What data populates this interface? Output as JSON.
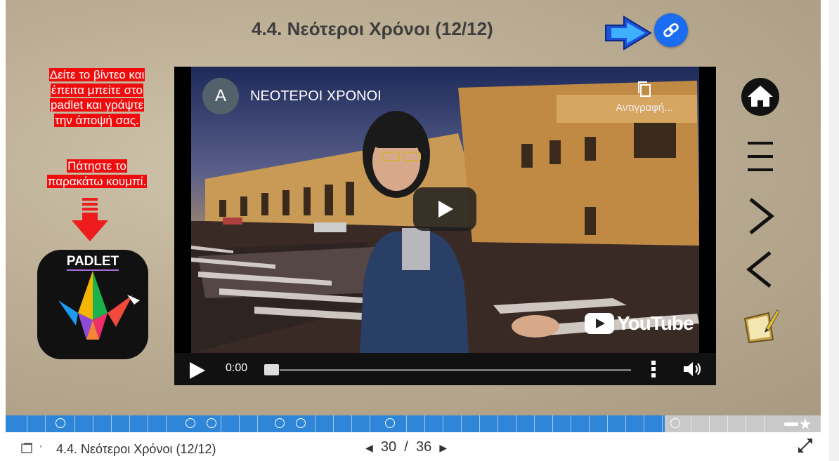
{
  "slide": {
    "title": "4.4. Νεότεροι Χρόνοι (12/12)",
    "instructions_line1": [
      "Δείτε το βίντεο και",
      "έπειτα μπείτε στο",
      "padlet και γράψτε",
      "την άποψή σας."
    ],
    "instructions_line2": [
      "Πάτηστε το",
      "παρακάτω κουμπί."
    ],
    "padlet_label": "PADLET"
  },
  "video": {
    "channel_initial": "A",
    "channel_title": "ΝΕΟΤΕΡΟΙ ΧΡΟΝΟΙ",
    "copy_label": "Αντιγραφή...",
    "youtube_label": "YouTube",
    "time": "0:00"
  },
  "footer": {
    "title": "4.4. Νεότεροι Χρόνοι (12/12)",
    "current_page": "30",
    "separator": "/",
    "total_pages": "36"
  },
  "colors": {
    "accent_blue": "#1a6cf0",
    "progress_blue": "#2f86d9",
    "instruction_red": "#ee0c0c"
  },
  "icons": [
    "blue-arrow-icon",
    "link-icon",
    "home-icon",
    "menu-icon",
    "next-icon",
    "prev-icon",
    "notes-icon",
    "fullscreen-icon",
    "book-icon"
  ]
}
